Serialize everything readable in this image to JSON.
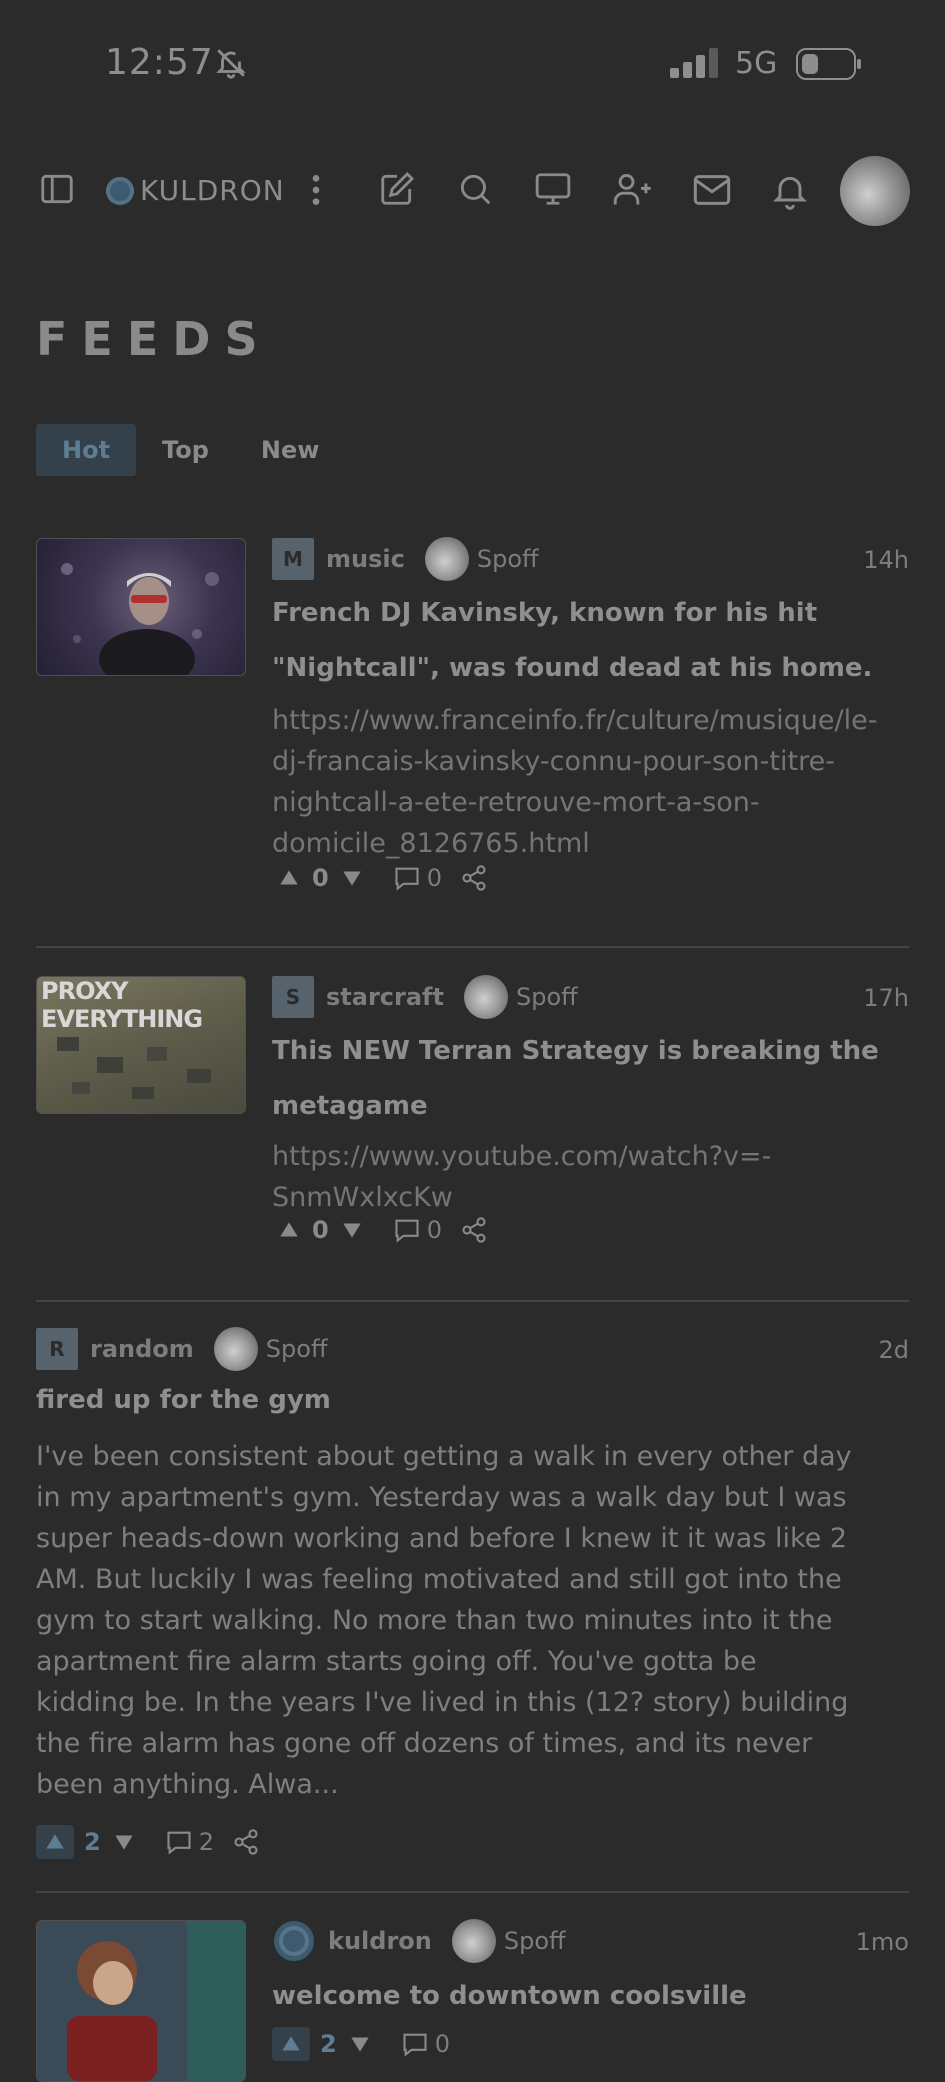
{
  "status": {
    "time": "12:57",
    "network": "5G"
  },
  "header": {
    "brand": "KULDRON"
  },
  "page": {
    "title": "FEEDS"
  },
  "tabs": [
    {
      "label": "Hot",
      "active": true
    },
    {
      "label": "Top",
      "active": false
    },
    {
      "label": "New",
      "active": false
    }
  ],
  "posts": [
    {
      "community_initial": "M",
      "community": "music",
      "user": "Spoff",
      "age": "14h",
      "title_lines": [
        "French DJ Kavinsky, known for his hit",
        "\"Nightcall\", was found dead at his home."
      ],
      "url_lines": [
        "https://www.franceinfo.fr/culture/musique/le-",
        "dj-francais-kavinsky-connu-pour-son-titre-",
        "nightcall-a-ete-retrouve-mort-a-son-",
        "domicile_8126765.html"
      ],
      "score": "0",
      "comments": "0"
    },
    {
      "community_initial": "S",
      "community": "starcraft",
      "user": "Spoff",
      "age": "17h",
      "thumb_text": "PROXY EVERYTHING",
      "title_lines": [
        "This NEW Terran Strategy is breaking the",
        "metagame"
      ],
      "url_lines": [
        "https://www.youtube.com/watch?v=-",
        "SnmWxlxcKw"
      ],
      "score": "0",
      "comments": "0"
    },
    {
      "community_initial": "R",
      "community": "random",
      "user": "Spoff",
      "age": "2d",
      "title": "fired up for the gym",
      "body_lines": [
        "I've been consistent about getting a walk in every other day",
        "in my apartment's gym. Yesterday was a walk day but I was",
        "super heads-down working and before I knew it it was like 2",
        "AM. But luckily I was feeling motivated and still got into the",
        "gym to start walking. No more than two minutes into it the",
        "apartment fire alarm starts going off. You've gotta be",
        "kidding be. In the years I've lived in this (12? story) building",
        "the fire alarm has gone off dozens of times, and its never",
        "been anything. Alwa..."
      ],
      "score": "2",
      "comments": "2"
    },
    {
      "community": "kuldron",
      "user": "Spoff",
      "age": "1mo",
      "title": "welcome to downtown coolsville",
      "score": "2",
      "comments": "0"
    }
  ]
}
